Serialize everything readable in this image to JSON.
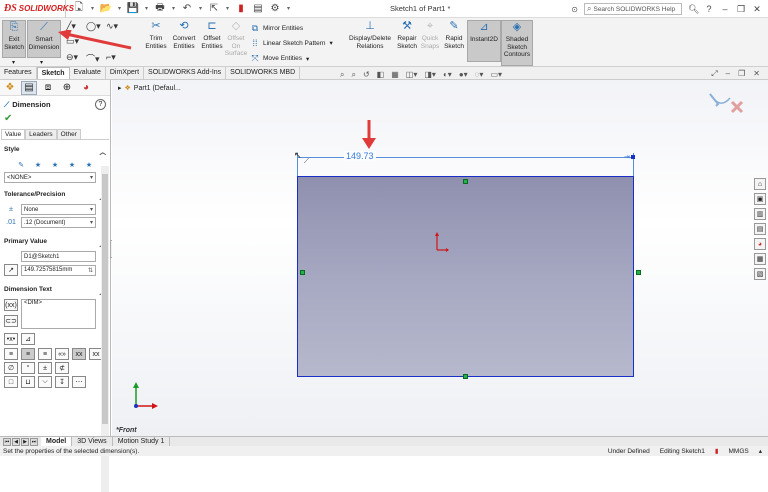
{
  "titlebar": {
    "brand": "SOLIDWORKS",
    "doc_title": "Sketch1 of Part1 *",
    "search_placeholder": "Search SOLIDWORKS Help",
    "help_label": "?"
  },
  "ribbon": {
    "exit_sketch": "Exit Sketch",
    "smart_dimension": "Smart Dimension",
    "trim_entities": "Trim Entities",
    "convert_entities": "Convert Entities",
    "offset_entities": "Offset Entities",
    "offset_on_surface": "Offset On Surface",
    "mirror_entities": "Mirror Entities",
    "linear_sketch_pattern": "Linear Sketch Pattern",
    "move_entities": "Move Entities",
    "display_delete_relations": "Display/Delete Relations",
    "repair_sketch": "Repair Sketch",
    "quick_snaps": "Quick Snaps",
    "rapid_sketch": "Rapid Sketch",
    "instant2d": "Instant2D",
    "shaded_sketch_contours": "Shaded Sketch Contours"
  },
  "tabs": [
    "Features",
    "Sketch",
    "Evaluate",
    "DimXpert",
    "SOLIDWORKS Add-Ins",
    "SOLIDWORKS MBD"
  ],
  "active_tab": "Sketch",
  "panel": {
    "title": "Dimension",
    "subtabs": [
      "Value",
      "Leaders",
      "Other"
    ],
    "style_label": "Style",
    "style_value": "<NONE>",
    "tolerance_label": "Tolerance/Precision",
    "tolerance_value": "None",
    "precision_value": ".12 (Document)",
    "primary_value_label": "Primary Value",
    "primary_name": "D1@Sketch1",
    "primary_value": "149.72575815mm",
    "dimension_text_label": "Dimension Text",
    "dimension_text_value": "<DIM>"
  },
  "canvas": {
    "tree_item": "Part1  (Defaul...",
    "dimension_value": "149.73",
    "view_label": "*Front"
  },
  "bottom_tabs": [
    "Model",
    "3D Views",
    "Motion Study 1"
  ],
  "active_bottom_tab": "Model",
  "status": {
    "message": "Set the properties of the selected dimension(s).",
    "definition": "Under Defined",
    "editing": "Editing Sketch1",
    "units": "MMGS"
  },
  "colors": {
    "brand_red": "#d42020",
    "sketch_blue": "#1a2ec8",
    "dimension_blue": "#3a7ad8",
    "annotation_red": "#e03a3a"
  }
}
